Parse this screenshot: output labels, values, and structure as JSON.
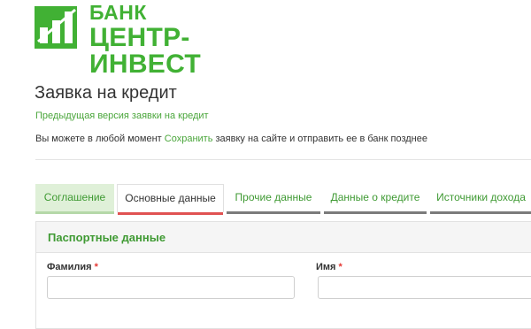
{
  "logo": {
    "line1": "БАНК",
    "line2": "ЦЕНТР-ИНВЕСТ",
    "color": "#41b134"
  },
  "page": {
    "title": "Заявка на кредит",
    "prev_link": "Предыдущая версия заявки на кредит",
    "info_prefix": "Вы можете в любой момент",
    "info_link": "Сохранить",
    "info_suffix": "заявку на сайте и отправить ее в банк позднее"
  },
  "tabs": [
    {
      "label": "Соглашение",
      "state": "done"
    },
    {
      "label": "Основные данные",
      "state": "current"
    },
    {
      "label": "Прочие данные",
      "state": "pending"
    },
    {
      "label": "Данные о кредите",
      "state": "pending"
    },
    {
      "label": "Источники дохода",
      "state": "pending"
    }
  ],
  "section": {
    "title": "Паспортные данные",
    "fields": [
      {
        "label": "Фамилия",
        "required": "*",
        "value": "",
        "placeholder": ""
      },
      {
        "label": "Имя",
        "required": "*",
        "value": "",
        "placeholder": ""
      }
    ]
  },
  "colors": {
    "accent": "#41b134",
    "link": "#4aa63b",
    "active_tab_bg": "#dff0d8",
    "current_tab_underline": "#e05252",
    "required": "#e53935"
  }
}
